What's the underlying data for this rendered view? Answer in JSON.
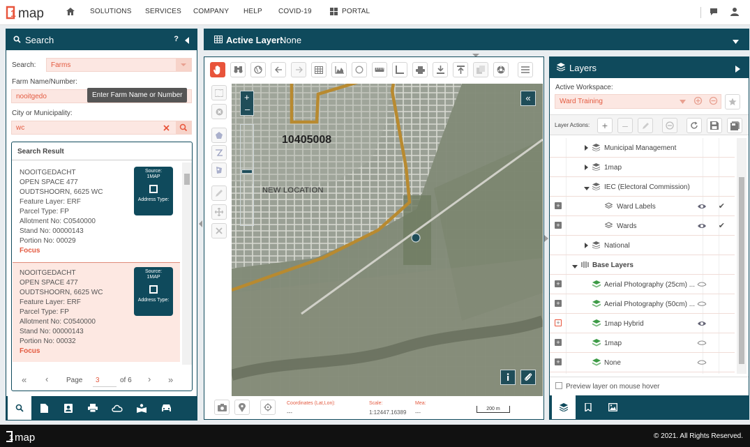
{
  "brand": {
    "logo_num": "1",
    "logo_text": "map",
    "accent": "#e8543b",
    "primary": "#0f4a5c"
  },
  "nav": {
    "items": [
      "SOLUTIONS",
      "SERVICES",
      "COMPANY",
      "HELP",
      "COVID-19",
      "PORTAL"
    ],
    "icons": [
      "home-icon",
      "chat-icon",
      "user-icon",
      "grid-icon"
    ]
  },
  "search": {
    "title": "Search",
    "help": "?",
    "search_label": "Search:",
    "search_value": "Farms",
    "farm_label": "Farm Name/Number:",
    "farm_value": "nooitgedo",
    "tooltip": "Enter Farm Name or Number",
    "city_label": "City or Municipality:",
    "city_value": "wc",
    "result_header": "Search Result",
    "results": [
      {
        "lines": [
          "NOOITGEDACHT",
          "OPEN SPACE 477",
          "OUDTSHOORN, 6625 WC",
          "Feature Layer: ERF",
          "Parcel Type: FP",
          "Allotment No: C0540000",
          "Stand No: 00000143",
          "Portion No: 00029"
        ],
        "focus": "Focus",
        "badge_source": "Source:",
        "badge_src_val": "1MAP",
        "badge_addr": "Address Type:"
      },
      {
        "lines": [
          "NOOITGEDACHT",
          "OPEN SPACE 477",
          "OUDTSHOORN, 6625 WC",
          "Feature Layer: ERF",
          "Parcel Type: FP",
          "Allotment No: C0540000",
          "Stand No: 00000143",
          "Portion No: 00032"
        ],
        "focus": "Focus",
        "badge_source": "Source:",
        "badge_src_val": "1MAP",
        "badge_addr": "Address Type:"
      }
    ],
    "pager": {
      "page_label": "Page",
      "page_value": "3",
      "of_label": "of 6"
    }
  },
  "active_layer": {
    "title_bold": "Active Layer:",
    "title_value": "None"
  },
  "map": {
    "parcel_label": "10405008",
    "place_label": "NEW LOCATION",
    "coords_label": "Coordinates (Lat,Lon):",
    "coords_value": "---",
    "scale_label": "Scale:",
    "scale_value": "1:12447.16389",
    "mea_label": "Mea:",
    "mea_value": "---",
    "scalebar": "200 m",
    "collapse": "«"
  },
  "layers": {
    "title": "Layers",
    "workspace_label": "Active Workspace:",
    "workspace_value": "Ward Training",
    "actions_label": "Layer Actions:",
    "rows": [
      {
        "name": "Municipal Management",
        "plus": false
      },
      {
        "name": "1map",
        "plus": false
      },
      {
        "name": "IEC (Electoral Commission)",
        "plus": false
      },
      {
        "name": "Ward Labels",
        "plus": true
      },
      {
        "name": "Wards",
        "plus": true
      },
      {
        "name": "National",
        "plus": false
      },
      {
        "name": "Base Layers",
        "plus": false
      },
      {
        "name": "Aerial Photography (25cm) ...",
        "plus": true
      },
      {
        "name": "Aerial Photography (50cm) ...",
        "plus": true
      },
      {
        "name": "1map Hybrid",
        "plus": true
      },
      {
        "name": "1map",
        "plus": true
      },
      {
        "name": "None",
        "plus": true
      }
    ],
    "preview_label": "Preview layer on mouse hover"
  },
  "footer": {
    "copyright": "© 2021. All Rights Reserved."
  }
}
